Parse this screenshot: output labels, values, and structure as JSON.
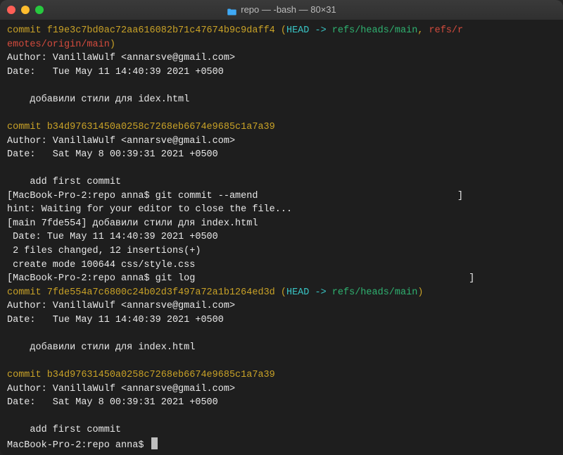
{
  "window": {
    "title": "repo — -bash — 80×31"
  },
  "colors": {
    "close": "#ff5f56",
    "minimize": "#ffbd2e",
    "zoom": "#27c93f"
  },
  "log1": {
    "commit1": {
      "prefix": "commit ",
      "hash": "f19e3c7bd0ac72aa616082b71c47674b9c9daff4",
      "open": " (",
      "head": "HEAD -> ",
      "branch": "refs/heads/main",
      "sep": ", ",
      "remote1": "refs/r",
      "remote2": "emotes/origin/main",
      "close": ")",
      "author": "Author: VanillaWulf <annarsve@gmail.com>",
      "date": "Date:   Tue May 11 14:40:39 2021 +0500",
      "msg": "    добавили стили для idex.html"
    },
    "commit2": {
      "line": "commit b34d97631450a0258c7268eb6674e9685c1a7a39",
      "author": "Author: VanillaWulf <annarsve@gmail.com>",
      "date": "Date:   Sat May 8 00:39:31 2021 +0500",
      "msg": "    add first commit"
    }
  },
  "amend": {
    "prompt1_open": "[",
    "prompt1": "MacBook-Pro-2:repo anna$ git commit --amend",
    "prompt1_close": "]",
    "hint": "hint: Waiting for your editor to close the file...",
    "result1": "[main 7fde554] добавили стили для index.html",
    "result2": " Date: Tue May 11 14:40:39 2021 +0500",
    "result3": " 2 files changed, 12 insertions(+)",
    "result4": " create mode 100644 css/style.css",
    "prompt2_open": "[",
    "prompt2": "MacBook-Pro-2:repo anna$ git log",
    "prompt2_close": "]"
  },
  "log2": {
    "commit1": {
      "prefix": "commit ",
      "hash": "7fde554a7c6800c24b02d3f497a72a1b1264ed3d",
      "open": " (",
      "head": "HEAD -> ",
      "branch": "refs/heads/main",
      "close": ")",
      "author": "Author: VanillaWulf <annarsve@gmail.com>",
      "date": "Date:   Tue May 11 14:40:39 2021 +0500",
      "msg": "    добавили стили для index.html"
    },
    "commit2": {
      "line": "commit b34d97631450a0258c7268eb6674e9685c1a7a39",
      "author": "Author: VanillaWulf <annarsve@gmail.com>",
      "date": "Date:   Sat May 8 00:39:31 2021 +0500",
      "msg": "    add first commit"
    }
  },
  "prompt_final": "MacBook-Pro-2:repo anna$ "
}
